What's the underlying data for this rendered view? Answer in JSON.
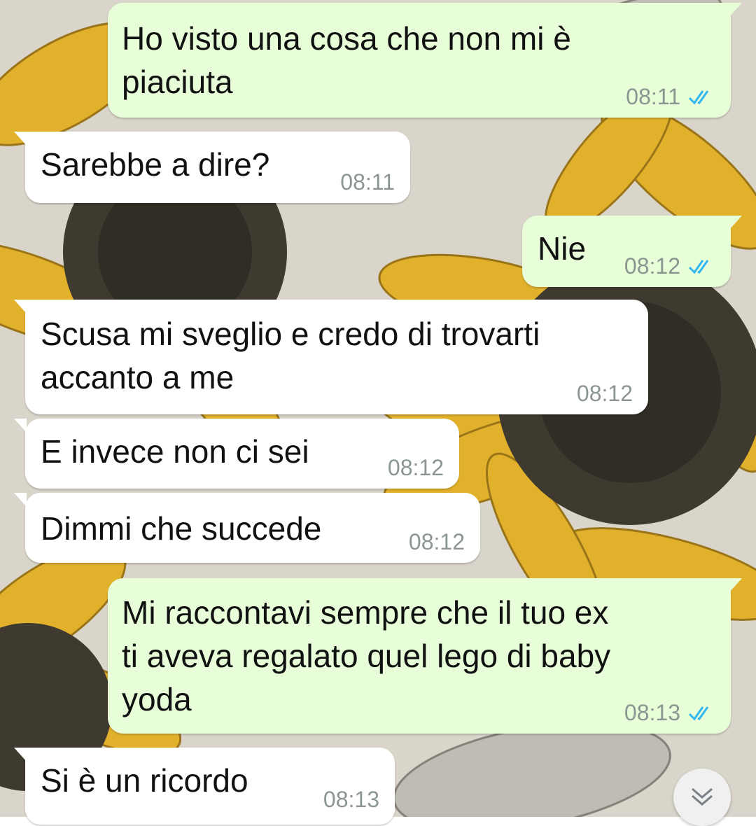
{
  "app": {
    "accent": "#34b7f1",
    "outgoing_bubble_color": "#e7fed9",
    "incoming_bubble_color": "#ffffff"
  },
  "messages": [
    {
      "dir": "out",
      "text": "Ho visto una cosa che non mi è\npiaciuta",
      "time": "08:11",
      "status": "read"
    },
    {
      "dir": "in",
      "text": "Sarebbe a dire?",
      "time": "08:11"
    },
    {
      "dir": "out",
      "text": "Nie",
      "time": "08:12",
      "status": "read"
    },
    {
      "dir": "in",
      "text": "Scusa mi sveglio e credo di trovarti\naccanto a me",
      "time": "08:12"
    },
    {
      "dir": "in",
      "text": "E invece non ci sei",
      "time": "08:12"
    },
    {
      "dir": "in",
      "text": "Dimmi che succede",
      "time": "08:12"
    },
    {
      "dir": "out",
      "text": "Mi raccontavi sempre che il tuo ex\nti aveva regalato quel lego di baby\nyoda",
      "time": "08:13",
      "status": "read"
    },
    {
      "dir": "in",
      "text": "Si è un ricordo",
      "time": "08:13"
    }
  ],
  "scroll_button": {
    "icon": "double-chevron-down-icon"
  }
}
